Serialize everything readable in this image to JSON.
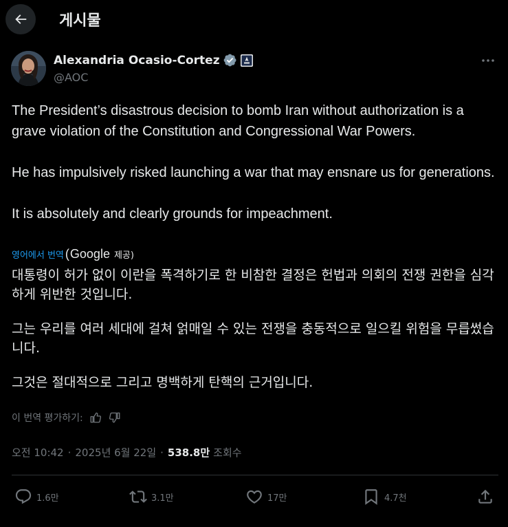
{
  "header": {
    "title": "게시물"
  },
  "author": {
    "display_name": "Alexandria Ocasio-Cortez",
    "handle": "@AOC"
  },
  "tweet": {
    "paragraphs": [
      "The President’s disastrous decision to bomb Iran without authorization is a grave violation of the Constitution and Congressional War Powers.",
      "He has impulsively risked launching a war that may ensnare us for generations.",
      "It is absolutely and clearly grounds for impeachment."
    ]
  },
  "translation": {
    "link_label": "영어에서 번역",
    "paren_open": "(",
    "google_label": "Google",
    "provided_label": "제공)",
    "paragraphs": [
      "대통령이 허가 없이 이란을 폭격하기로 한 비참한 결정은 헌법과 의회의 전쟁 권한을 심각하게 위반한 것입니다.",
      "그는 우리를 여러 세대에 걸쳐 얽매일 수 있는 전쟁을 충동적으로 일으킬 위험을 무릅썼습니다.",
      "그것은 절대적으로 그리고 명백하게 탄핵의 근거입니다."
    ],
    "rate_label": "이 번역 평가하기:"
  },
  "meta": {
    "time": "오전 10:42",
    "separator": "·",
    "date": "2025년 6월 22일",
    "views_count": "538.8만",
    "views_label": "조회수"
  },
  "actions": {
    "replies": "1.6만",
    "reposts": "3.1만",
    "likes": "17만",
    "bookmarks": "4.7천"
  },
  "colors": {
    "background": "#000000",
    "text": "#e7e9ea",
    "muted": "#71767b",
    "link": "#1d9bf0",
    "verified": "#829aab"
  }
}
